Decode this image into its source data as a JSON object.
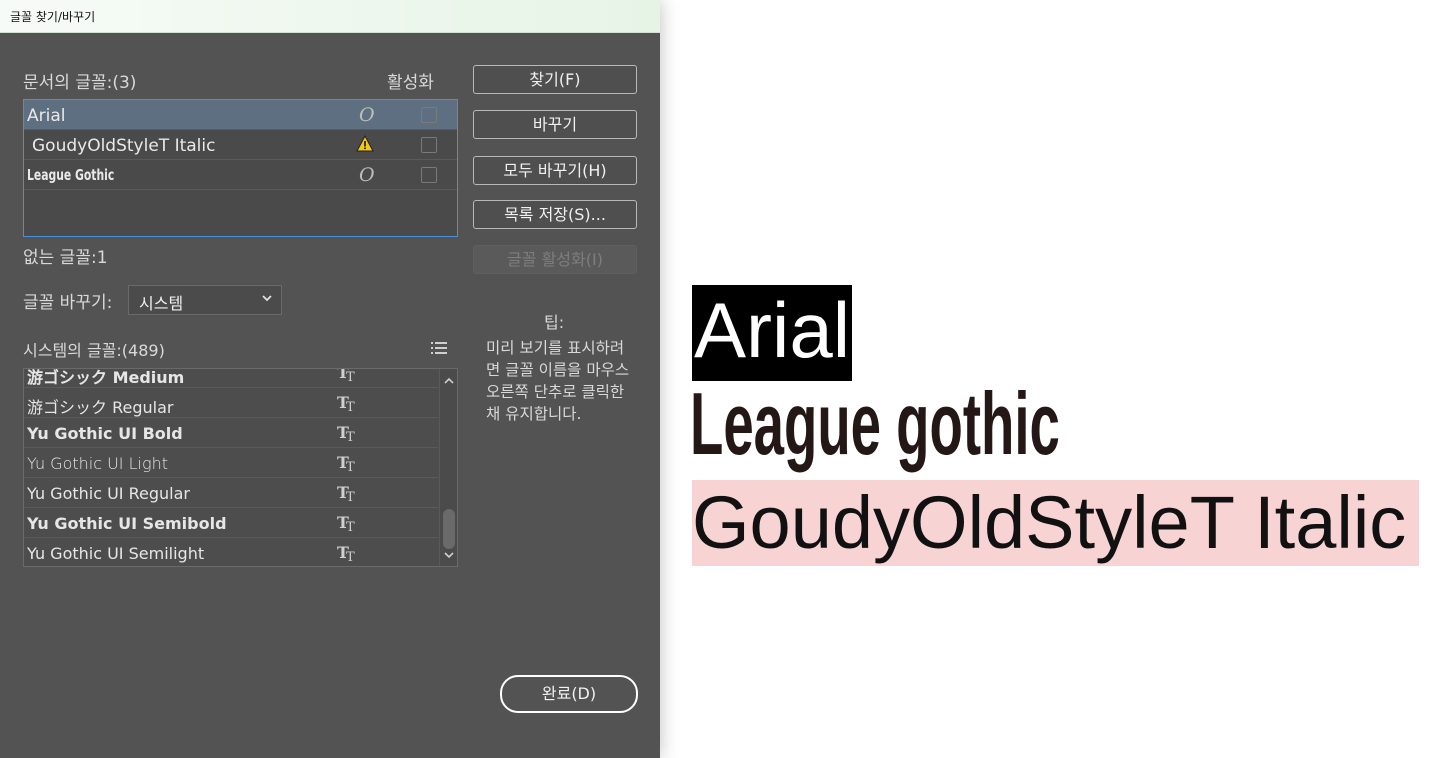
{
  "window": {
    "title": "글꼴 찾기/바꾸기"
  },
  "doc_fonts": {
    "label": "문서의 글꼴:(3)",
    "activate_header": "활성화",
    "items": [
      {
        "name": "Arial",
        "icon": "opentype-icon",
        "selected": true
      },
      {
        "name": "GoudyOldStyleT Italic",
        "icon": "warning-icon",
        "selected": false
      },
      {
        "name": "League Gothic",
        "icon": "opentype-icon",
        "selected": false
      }
    ],
    "missing": "없는 글꼴:1"
  },
  "buttons": {
    "find": "찾기(F)",
    "replace": "바꾸기",
    "replace_all": "모두 바꾸기(H)",
    "save_list": "목록 저장(S)...",
    "activate_fonts": "글꼴 활성화(I)",
    "done": "완료(D)"
  },
  "replace_with": {
    "label": "글꼴 바꾸기:",
    "value": "시스템"
  },
  "system_fonts": {
    "label": "시스템의 글꼴:(489)",
    "items": [
      {
        "name": "游ゴシック Medium"
      },
      {
        "name": "游ゴシック Regular"
      },
      {
        "name": "Yu Gothic UI Bold",
        "bold": true
      },
      {
        "name": "Yu Gothic UI Light"
      },
      {
        "name": "Yu Gothic UI Regular"
      },
      {
        "name": "Yu Gothic UI Semibold",
        "bold": true
      },
      {
        "name": "Yu Gothic UI Semilight"
      }
    ]
  },
  "tip": {
    "title": "팁:",
    "text": "미리 보기를 표시하려면 글꼴 이름을 마우스 오른쪽 단추로 클릭한 채 유지합니다."
  },
  "samples": {
    "arial": "Arial",
    "league": "League gothic",
    "goudy": "GoudyOldStyleT Italic"
  }
}
